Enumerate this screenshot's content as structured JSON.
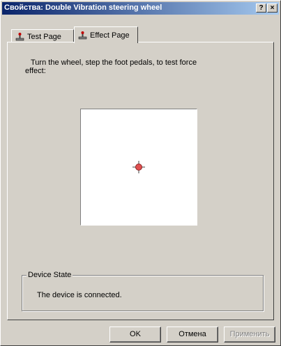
{
  "window": {
    "title": "Свойства: Double Vibration steering wheel",
    "help_label": "?",
    "close_label": "×"
  },
  "tabs": [
    {
      "label": "Test Page",
      "icon": "joystick-icon",
      "active": false
    },
    {
      "label": "Effect Page",
      "icon": "joystick-icon",
      "active": true
    }
  ],
  "effect_page": {
    "instructions": "Turn the wheel, step the foot pedals, to test force effect:"
  },
  "device_state": {
    "group_label": "Device State",
    "status": "The device is connected."
  },
  "buttons": {
    "ok": "OK",
    "cancel": "Отмена",
    "apply": "Применить"
  }
}
